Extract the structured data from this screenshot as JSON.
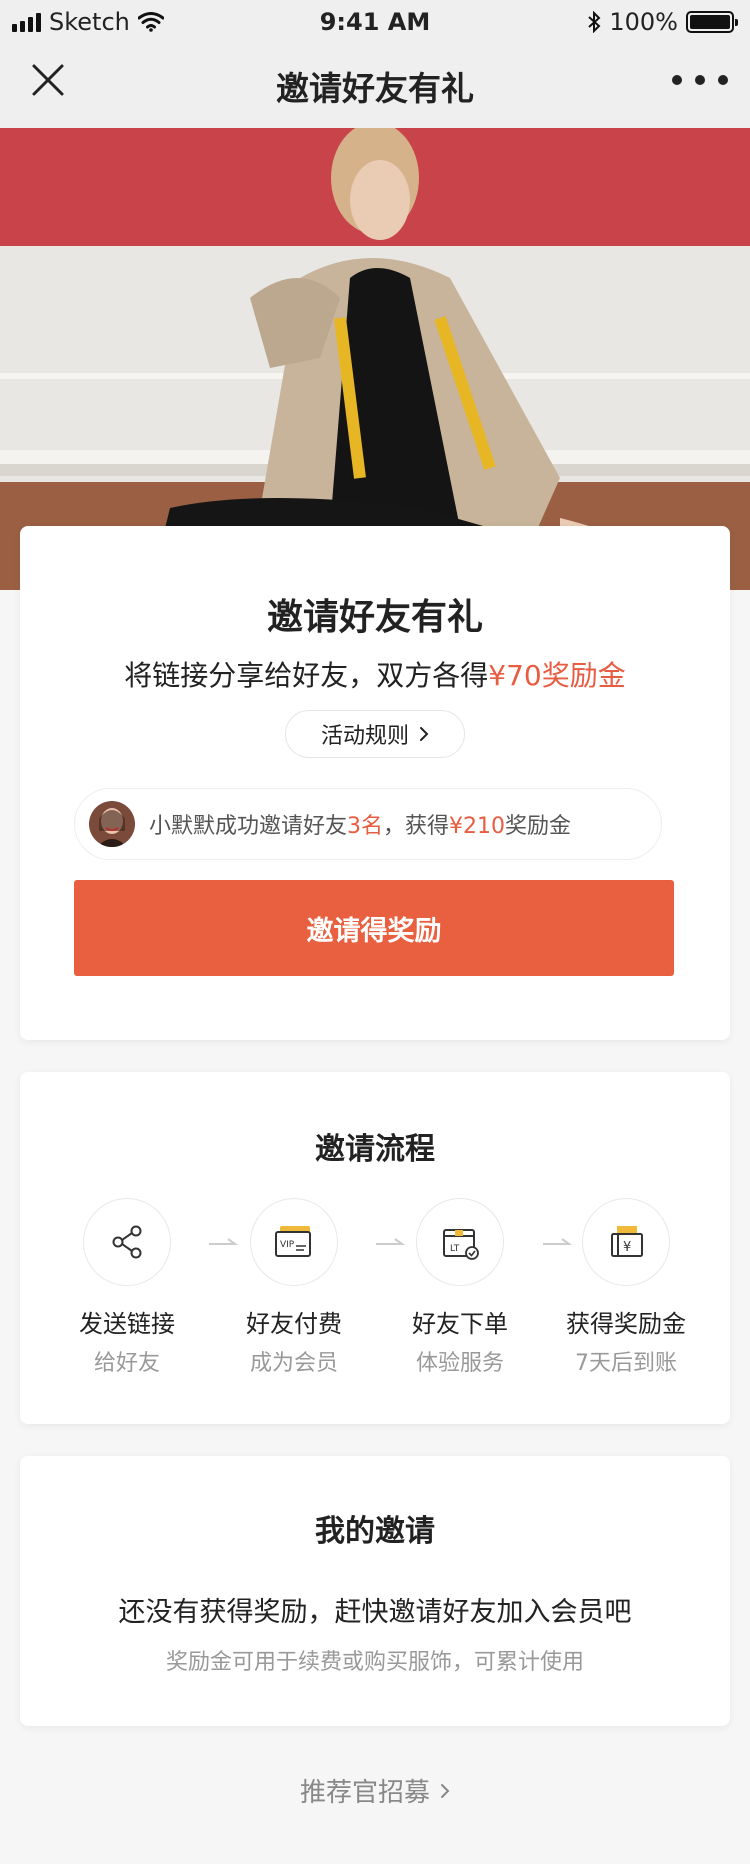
{
  "status_bar": {
    "carrier": "Sketch",
    "time": "9:41 AM",
    "battery": "100%",
    "battery_level": 1.0
  },
  "nav": {
    "title": "邀请好友有礼",
    "icons": {
      "close": "close-icon",
      "more": "more-icon"
    }
  },
  "main_card": {
    "title": "邀请好友有礼",
    "subtitle_prefix": "将链接分享给好友，双方各得",
    "subtitle_highlight": "¥70奖励金",
    "rules_label": "活动规则",
    "notice": {
      "part1": "小默默成功邀请好友",
      "count": "3名",
      "part2": "，获得",
      "amount": "¥210",
      "part3": "奖励金"
    },
    "cta_label": "邀请得奖励"
  },
  "flow_card": {
    "title": "邀请流程",
    "steps": [
      {
        "label": "发送链接",
        "sub": "给好友",
        "icon": "share-icon"
      },
      {
        "label": "好友付费",
        "sub": "成为会员",
        "icon": "vip-card-icon"
      },
      {
        "label": "好友下单",
        "sub": "体验服务",
        "icon": "package-icon"
      },
      {
        "label": "获得奖励金",
        "sub": "7天后到账",
        "icon": "money-envelope-icon"
      }
    ]
  },
  "mine_card": {
    "title": "我的邀请",
    "message": "还没有获得奖励，赶快邀请好友加入会员吧",
    "sub": "奖励金可用于续费或购买服饰，可累计使用"
  },
  "footer": {
    "link": "推荐官招募"
  },
  "colors": {
    "accent": "#e85c41",
    "cta": "#e8603f",
    "hero_wall": "#c8434a"
  }
}
